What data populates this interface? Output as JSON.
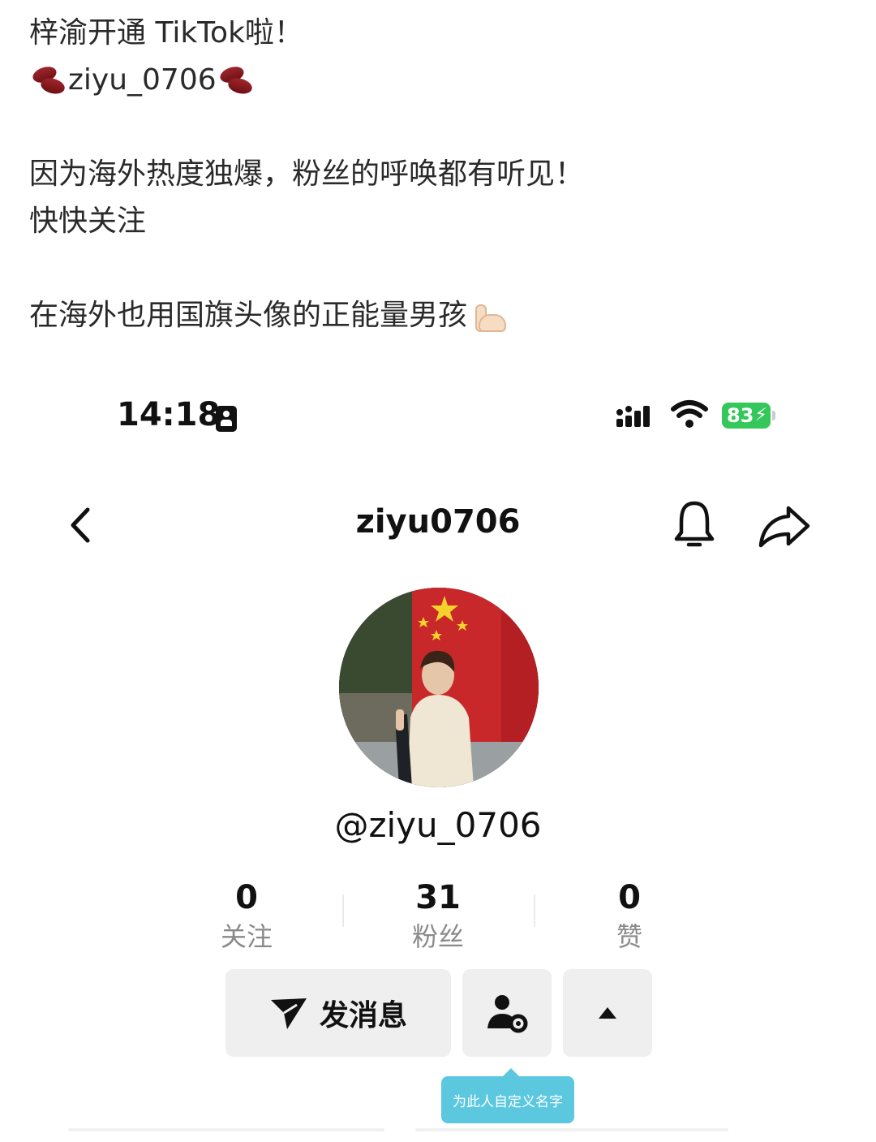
{
  "post": {
    "line1": "梓渝开通 TikTok啦！",
    "line2_handle": "ziyu_0706",
    "line3": "因为海外热度独爆，粉丝的呼唤都有听见！",
    "line4": "快快关注",
    "line5": "在海外也用国旗头像的正能量男孩"
  },
  "status_bar": {
    "time": "14:18",
    "battery": "83"
  },
  "profile": {
    "nav_title": "ziyu0706",
    "handle": "@ziyu_0706",
    "stats": [
      {
        "value": "0",
        "label": "关注"
      },
      {
        "value": "31",
        "label": "粉丝"
      },
      {
        "value": "0",
        "label": "赞"
      }
    ],
    "message_button": "发消息",
    "tooltip": "为此人自定义名字"
  },
  "icons": [
    "bean-emoji",
    "flexed-biceps-emoji",
    "contact-card-icon",
    "signal-icon",
    "wifi-icon",
    "battery-icon",
    "back-icon",
    "bell-icon",
    "share-icon",
    "send-icon",
    "user-settings-icon",
    "caret-up-icon"
  ],
  "colors": {
    "battery": "#34c759",
    "tooltip": "#5cc8df",
    "button_bg": "#efefef",
    "label_gray": "#8a8a8a"
  }
}
